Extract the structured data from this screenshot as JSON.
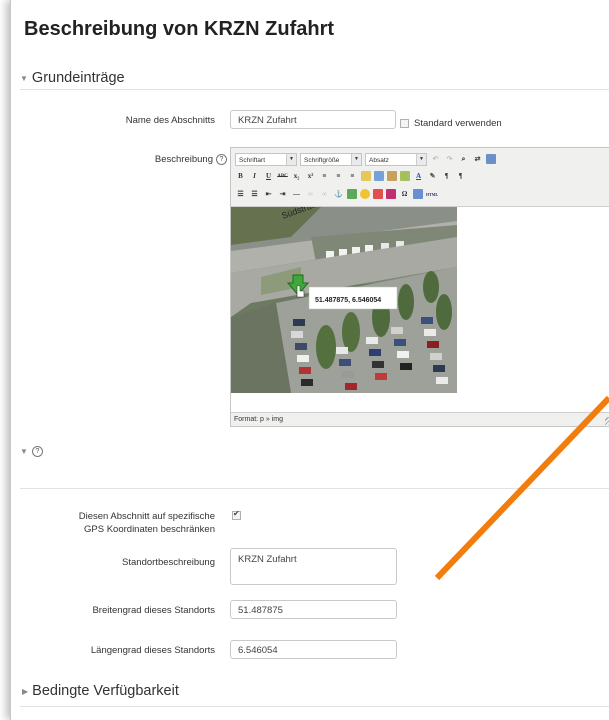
{
  "page": {
    "title": "Beschreibung von KRZN Zufahrt"
  },
  "sections": {
    "grund": "Grundeinträge",
    "gps": "",
    "bedingt": "Bedingte Verfügbarkeit"
  },
  "fields": {
    "name_label": "Name des Abschnitts",
    "name_value": "KRZN Zufahrt",
    "standard_label": "Standard verwenden",
    "beschreibung_label": "Beschreibung",
    "gps_restrict_label_1": "Diesen Abschnitt auf spezifische",
    "gps_restrict_label_2": "GPS Koordinaten beschränken",
    "standort_label": "Standortbeschreibung",
    "standort_value": "KRZN Zufahrt",
    "breite_label": "Breitengrad dieses Standorts",
    "breite_value": "51.487875",
    "laenge_label": "Längengrad dieses Standorts",
    "laenge_value": "6.546054"
  },
  "editor": {
    "font_select": "Schriftart",
    "size_select": "Schriftgröße",
    "format_select": "Absatz",
    "status": "Format: p » img",
    "map_street": "Südstraße",
    "map_coords": "51.487875, 6.546054"
  },
  "colors": {
    "accent_arrow": "#f27d0c",
    "marker": "#3fa83a"
  }
}
